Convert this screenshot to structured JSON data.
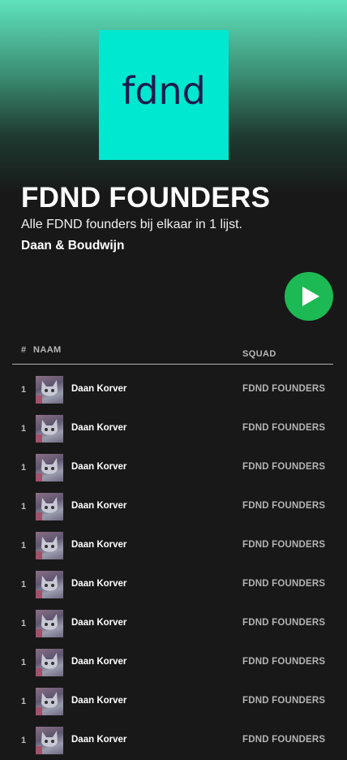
{
  "playlist": {
    "cover_text": "fdnd",
    "title": "FDND FOUNDERS",
    "description": "Alle FDND founders bij elkaar in 1 lijst.",
    "authors": "Daan & Boudwijn",
    "play_icon": "play-icon",
    "colors": {
      "cover": "#00e8cf",
      "play": "#1db954",
      "background": "#181818"
    }
  },
  "table": {
    "headers": {
      "number": "#",
      "name": "NAAM",
      "squad": "SQUAD"
    },
    "rows": [
      {
        "number": "1",
        "name": "Daan Korver",
        "squad": "FDND FOUNDERS"
      },
      {
        "number": "1",
        "name": "Daan Korver",
        "squad": "FDND FOUNDERS"
      },
      {
        "number": "1",
        "name": "Daan Korver",
        "squad": "FDND FOUNDERS"
      },
      {
        "number": "1",
        "name": "Daan Korver",
        "squad": "FDND FOUNDERS"
      },
      {
        "number": "1",
        "name": "Daan Korver",
        "squad": "FDND FOUNDERS"
      },
      {
        "number": "1",
        "name": "Daan Korver",
        "squad": "FDND FOUNDERS"
      },
      {
        "number": "1",
        "name": "Daan Korver",
        "squad": "FDND FOUNDERS"
      },
      {
        "number": "1",
        "name": "Daan Korver",
        "squad": "FDND FOUNDERS"
      },
      {
        "number": "1",
        "name": "Daan Korver",
        "squad": "FDND FOUNDERS"
      },
      {
        "number": "1",
        "name": "Daan Korver",
        "squad": "FDND FOUNDERS"
      }
    ]
  }
}
